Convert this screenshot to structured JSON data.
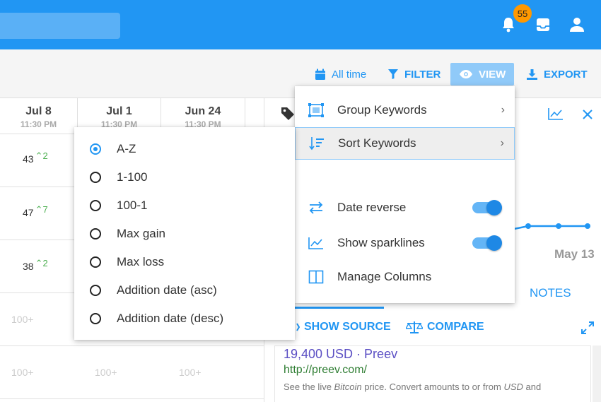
{
  "header": {
    "notification_count": "55"
  },
  "toolbar": {
    "date_range": "All time",
    "filter": "FILTER",
    "view": "VIEW",
    "export": "EXPORT"
  },
  "columns": [
    {
      "date": "Jul 8",
      "time": "11:30 PM"
    },
    {
      "date": "Jul 1",
      "time": "11:30 PM"
    },
    {
      "date": "Jun 24",
      "time": "11:30 PM"
    }
  ],
  "rows": [
    {
      "value": "43",
      "change": "2"
    },
    {
      "value": "47",
      "change": "7"
    },
    {
      "value": "38",
      "change": "2"
    }
  ],
  "muted_cells": [
    "100+",
    "100+",
    "100+",
    "100+"
  ],
  "view_menu": {
    "group_keywords": "Group Keywords",
    "sort_keywords": "Sort Keywords",
    "date_reverse": "Date reverse",
    "show_sparklines": "Show sparklines",
    "manage_columns": "Manage Columns"
  },
  "sort_menu": {
    "options": [
      "A-Z",
      "1-100",
      "100-1",
      "Max gain",
      "Max loss",
      "Addition date (asc)",
      "Addition date (desc)"
    ],
    "selected": "A-Z"
  },
  "panel": {
    "chart_label": "May 13",
    "notes_tab": "NOTES",
    "show_source": "SHOW SOURCE",
    "compare": "COMPARE"
  },
  "result": {
    "title": "19,400 USD · Preev",
    "url": "http://preev.com/",
    "desc_prefix": "See the live ",
    "desc_italic1": "Bitcoin",
    "desc_mid": " price. Convert amounts to or from ",
    "desc_italic2": "USD",
    "desc_suffix": " and"
  },
  "colors": {
    "primary": "#2196f3",
    "badge": "#ff9800",
    "gain": "#4caf50"
  }
}
